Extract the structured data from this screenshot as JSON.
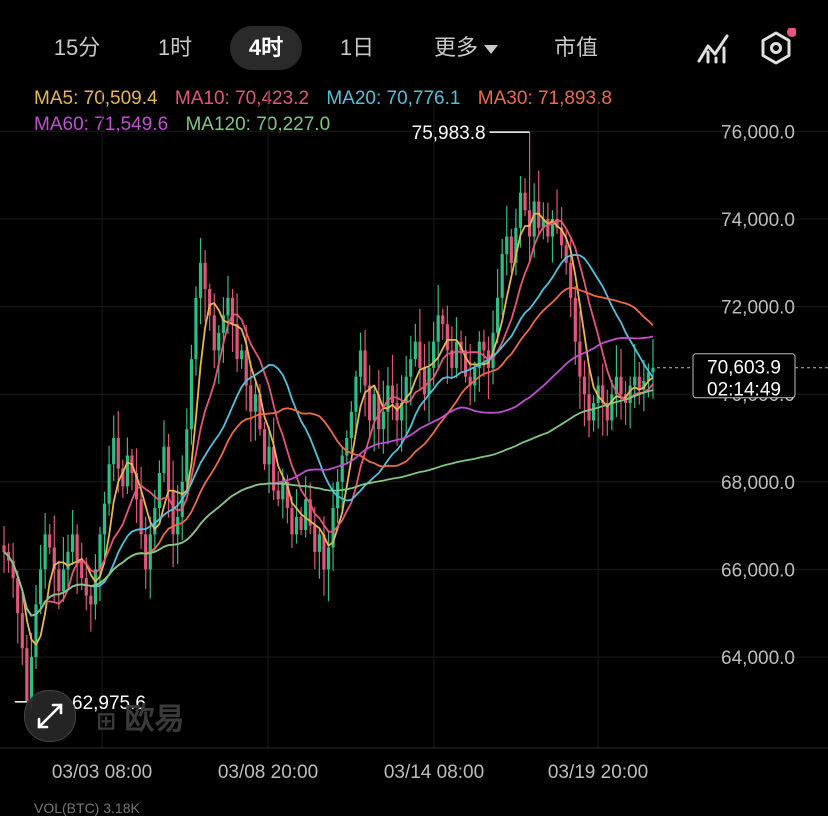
{
  "toolbar": {
    "tabs": [
      {
        "label": "15分",
        "active": false
      },
      {
        "label": "1时",
        "active": false
      },
      {
        "label": "4时",
        "active": true
      },
      {
        "label": "1日",
        "active": false
      },
      {
        "label": "更多",
        "active": false
      },
      {
        "label": "市值",
        "active": false
      }
    ]
  },
  "ma_legend": [
    {
      "label": "MA5: 70,509.4",
      "color": "#e9b84a"
    },
    {
      "label": "MA10: 70,423.2",
      "color": "#e8557a"
    },
    {
      "label": "MA20: 70,776.1",
      "color": "#4fc3dc"
    },
    {
      "label": "MA30: 71,893.8",
      "color": "#ef6a45"
    },
    {
      "label": "MA60: 71,549.6",
      "color": "#c050d0"
    },
    {
      "label": "MA120: 70,227.0",
      "color": "#7fc87f"
    }
  ],
  "price_marker": {
    "price": "70,603.9",
    "countdown": "02:14:49"
  },
  "watermark": "欧易",
  "volume_peek": "VOL(BTC) 3.18K",
  "chart_data": {
    "type": "candlestick",
    "x_ticks": [
      "03/03 08:00",
      "03/08 20:00",
      "03/14 08:00",
      "03/19 20:00"
    ],
    "y_ticks": [
      64000,
      66000,
      68000,
      70000,
      72000,
      74000,
      76000
    ],
    "y_tick_labels": [
      "64,000.0",
      "66,000.0",
      "68,000.0",
      "70,000.0",
      "72,000.0",
      "74,000.0",
      "76,000.0"
    ],
    "ylim": [
      62800,
      77000
    ],
    "high_label": "75,983.8",
    "low_label": "62,975.6",
    "high": 75983.8,
    "low": 62975.6,
    "last": 70603.9,
    "up_color": "#2ebd85",
    "down_color": "#e0557a",
    "closes": [
      66400,
      66200,
      65800,
      65000,
      64200,
      63000,
      64000,
      65200,
      66000,
      66800,
      66500,
      66000,
      65500,
      66000,
      66400,
      66800,
      66200,
      65800,
      65400,
      65200,
      66000,
      66800,
      67500,
      68400,
      69000,
      68300,
      67900,
      68600,
      68200,
      67600,
      66800,
      66000,
      66800,
      67400,
      68200,
      68800,
      67800,
      66800,
      67200,
      68000,
      69200,
      70800,
      72200,
      73000,
      72400,
      71800,
      71000,
      71400,
      71800,
      72200,
      71600,
      70800,
      71000,
      70200,
      69600,
      70000,
      69200,
      68400,
      68800,
      67800,
      67600,
      68000,
      67400,
      66800,
      67200,
      66900,
      67600,
      67000,
      66400,
      66800,
      66000,
      66500,
      67400,
      68000,
      68600,
      69000,
      69600,
      70400,
      71000,
      70200,
      69400,
      70000,
      69200,
      69600,
      70200,
      69800,
      69400,
      69800,
      70400,
      70800,
      71200,
      70600,
      70000,
      70600,
      71200,
      71800,
      71600,
      71000,
      70600,
      71200,
      71000,
      70400,
      70200,
      70600,
      71200,
      71000,
      70600,
      71400,
      72200,
      73200,
      73600,
      73000,
      73800,
      74600,
      74200,
      73600,
      74400,
      73800,
      74000,
      73600,
      74000,
      73800,
      73400,
      73000,
      72200,
      71200,
      70400,
      70000,
      69400,
      69800,
      70200,
      69800,
      69400,
      70000,
      70400,
      70000,
      69800,
      70200,
      70400,
      70100,
      70300,
      70500,
      70604
    ],
    "ma_series": [
      {
        "label": "MA5",
        "color": "#e9b84a",
        "window": 5
      },
      {
        "label": "MA10",
        "color": "#e8557a",
        "window": 10
      },
      {
        "label": "MA20",
        "color": "#4fc3dc",
        "window": 20
      },
      {
        "label": "MA30",
        "color": "#ef6a45",
        "window": 30
      },
      {
        "label": "MA60",
        "color": "#c050d0",
        "window": 60
      },
      {
        "label": "MA120",
        "color": "#7fc87f",
        "window": 120
      }
    ]
  }
}
